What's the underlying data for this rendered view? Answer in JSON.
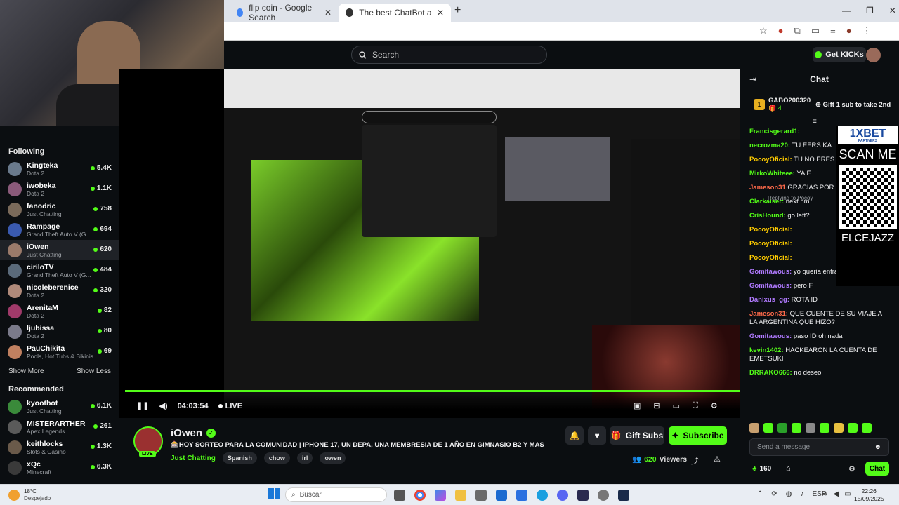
{
  "browser": {
    "tabs": [
      {
        "label": "flip coin - Google Search"
      },
      {
        "label": "The best ChatBot and Widgets"
      }
    ],
    "new_tab": "+"
  },
  "topbar": {
    "search_placeholder": "Search",
    "get_kicks": "Get KICKs"
  },
  "sidebar": {
    "following_title": "Following",
    "following": [
      {
        "name": "Kingteka",
        "game": "Dota 2",
        "viewers": "5.4K",
        "color": "#6a7a8c"
      },
      {
        "name": "iwobeka",
        "game": "Dota 2",
        "viewers": "1.1K",
        "color": "#8a5a7a"
      },
      {
        "name": "fanodric",
        "game": "Just Chatting",
        "viewers": "758",
        "color": "#7a6a5a"
      },
      {
        "name": "Rampage",
        "game": "Grand Theft Auto V (G...",
        "viewers": "694",
        "color": "#3a5ab0"
      },
      {
        "name": "iOwen",
        "game": "Just Chatting",
        "viewers": "620",
        "color": "#9a7a6a"
      },
      {
        "name": "ciriloTV",
        "game": "Grand Theft Auto V (G...",
        "viewers": "484",
        "color": "#5a6a7a"
      },
      {
        "name": "nicoleberenice",
        "game": "Dota 2",
        "viewers": "320",
        "color": "#b08a7a"
      },
      {
        "name": "ArenitaM",
        "game": "Dota 2",
        "viewers": "82",
        "color": "#a03a6a"
      },
      {
        "name": "ljubissa",
        "game": "Dota 2",
        "viewers": "80",
        "color": "#7a7a8a"
      },
      {
        "name": "PauChikita",
        "game": "Pools, Hot Tubs & Bikinis",
        "viewers": "69",
        "color": "#c08060"
      }
    ],
    "show_more": "Show More",
    "show_less": "Show Less",
    "recommended_title": "Recommended",
    "recommended": [
      {
        "name": "kyootbot",
        "game": "Just Chatting",
        "viewers": "6.1K",
        "color": "#3a8a3a"
      },
      {
        "name": "MISTERARTHER",
        "game": "Apex Legends",
        "viewers": "261",
        "color": "#5a5a5a"
      },
      {
        "name": "keithlocks",
        "game": "Slots & Casino",
        "viewers": "1.3K",
        "color": "#6a5a4a"
      },
      {
        "name": "xQc",
        "game": "Minecraft",
        "viewers": "6.3K",
        "color": "#3a3a3a"
      }
    ]
  },
  "video": {
    "time": "04:03:54",
    "live_label": "LIVE"
  },
  "info": {
    "channel_name": "iOwen",
    "title": "🎰HOY SORTEO PARA LA COMUNIDAD | IPHONE 17, UN DEPA, UNA MEMBRESIA DE 1 AÑO EN GIMNASIO B2 Y MAS",
    "category": "Just Chatting",
    "tags": [
      "Spanish",
      "chow",
      "irl",
      "owen"
    ],
    "gift_subs": "Gift Subs",
    "subscribe": "Subscribe",
    "viewers": "620",
    "viewers_label": "Viewers",
    "live_badge": "LIVE"
  },
  "chat": {
    "title": "Chat",
    "pinned_user": "GABO200320",
    "pinned_count": "4",
    "pinned_text": "Gift 1 sub to take 2nd",
    "messages": [
      {
        "user": "Francisgerard1:",
        "text": "",
        "color": "#53fc18"
      },
      {
        "user": "necrozma20:",
        "text": "TU EERS KA",
        "color": "#53fc18"
      },
      {
        "user": "PocoyOficial:",
        "text": "TU NO ERES KEKA",
        "color": "#ffcc00"
      },
      {
        "user": "MirkoWhiteee:",
        "text": "YA E",
        "color": "#53fc18"
      },
      {
        "user": "Jameson31",
        "text": "GRACIAS POR EL D",
        "color": "#ff6a4a"
      },
      {
        "user": "Clarkaiser:",
        "text": "next nm",
        "color": "#53fc18"
      },
      {
        "user": "CrisHound:",
        "text": "go left?",
        "color": "#53fc18"
      },
      {
        "user": "PocoyOficial:",
        "text": "",
        "color": "#ffcc00"
      },
      {
        "user": "PocoyOficial:",
        "text": "",
        "color": "#ffcc00"
      },
      {
        "user": "PocoyOficial:",
        "text": "",
        "color": "#ffcc00"
      },
      {
        "user": "Gomitawous:",
        "text": "yo queria entrar xd",
        "color": "#b07aff"
      },
      {
        "user": "Gomitawous:",
        "text": "pero F",
        "color": "#b07aff"
      },
      {
        "user": "Danixus_gg:",
        "text": "ROTA ID",
        "color": "#b07aff"
      },
      {
        "user": "Jameson31:",
        "text": "QUE CUENTE DE SU VIAJE A LA ARGENTINA QUE HIZO?",
        "color": "#ff6a4a"
      },
      {
        "user": "Gomitawous:",
        "text": "paso ID oh nada",
        "color": "#b07aff"
      },
      {
        "user": "kevin1402:",
        "text": "HACKEARON LA CUENTA DE EMETSUKI",
        "color": "#53fc18"
      },
      {
        "user": "DRRAKO666:",
        "text": "no deseo",
        "color": "#53fc18"
      }
    ],
    "replying_to": "Replying to Pocoy",
    "ad_brand": "1XBET",
    "ad_sub": "PARTNERS",
    "ad_scan": "SCAN ME",
    "ad_code": "ELCEJAZZ",
    "input_placeholder": "Send a message",
    "points": "160",
    "chat_button": "Chat"
  },
  "taskbar": {
    "weather_temp": "18°C",
    "weather_desc": "Despejado",
    "search": "Buscar",
    "lang": "ESP",
    "time": "22:26",
    "date": "15/09/2025"
  },
  "colors": {
    "accent": "#53fc18",
    "bg": "#0b0e11"
  }
}
